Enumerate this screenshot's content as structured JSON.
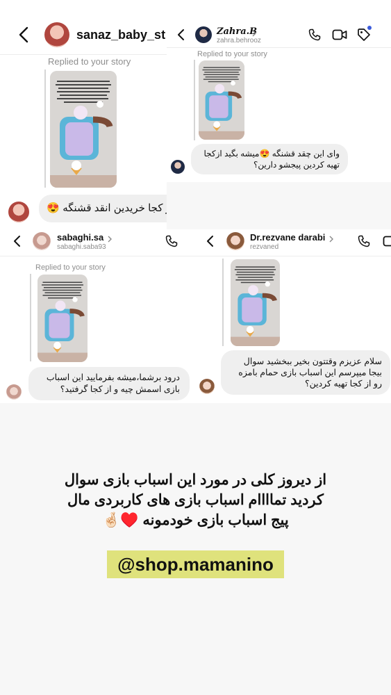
{
  "colors": {
    "background": "#f7f7f7",
    "bubble": "#efefef",
    "highlight": "#dfe27c",
    "notification_dot": "#3b5bdb"
  },
  "chat1": {
    "username": "sanaz_baby_st",
    "replied_label": "Replied to your story",
    "message": "این از کجا خریدین انقد قشنگه 😍"
  },
  "chat2": {
    "display_name": "Zahra.B",
    "username": "zahra.behrooz",
    "replied_label": "Replied to your story",
    "message": "وای این چقد قشنگه 😍میشه بگید ازکجا تهیه کردین پیجشو دارین؟"
  },
  "chat3": {
    "display_name": "sabaghi.sa",
    "username": "sabaghi.saba93",
    "replied_label": "Replied to your story",
    "message": "درود برشما،میشه بفرمایید این اسباب بازی اسمش چیه و از کجا گرفتید؟"
  },
  "chat4": {
    "display_name": "Dr.rezvane darabi",
    "username": "rezvaned",
    "message": "سلام عزیزم وقتتون بخیر ببخشید سوال بیجا میپرسم این اسباب بازی حمام بامزه رو از کجا تهیه کردین؟"
  },
  "caption": {
    "line1": "از دیروز کلی در مورد این اسباب بازی سوال",
    "line2": "کردید تماااام اسباب بازی های کاربردی مال",
    "line3": "پیج اسباب بازی خودمونه ♥️🤞🏻"
  },
  "handle": "@shop.mamanino"
}
